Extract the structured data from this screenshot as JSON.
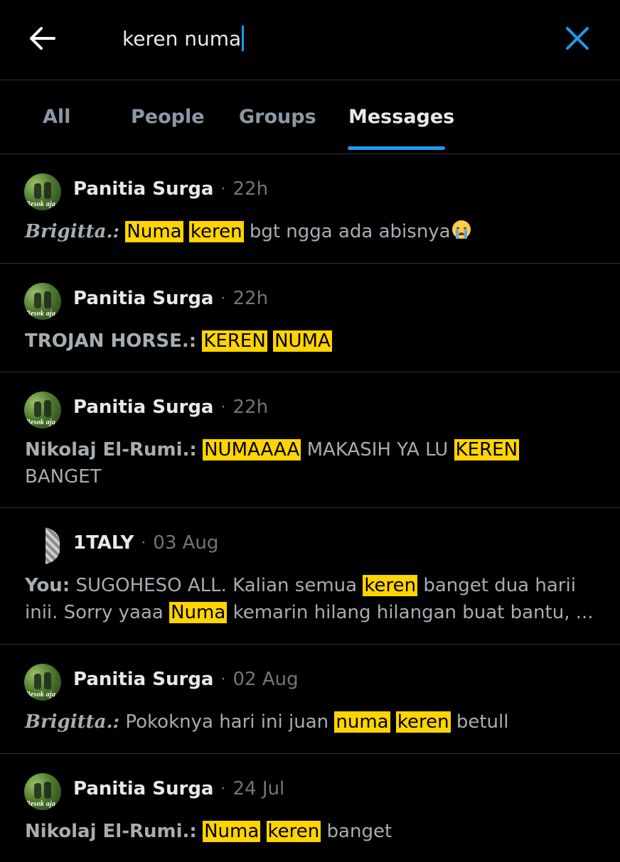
{
  "search": {
    "query": "keren numa"
  },
  "tabs": [
    {
      "label": "All",
      "active": false
    },
    {
      "label": "People",
      "active": false
    },
    {
      "label": "Groups",
      "active": false
    },
    {
      "label": "Messages",
      "active": true
    }
  ],
  "colors": {
    "accent": "#1d9bf0",
    "highlight": "#ffd400",
    "background": "#000000"
  },
  "icons": {
    "back": "arrow-left-icon",
    "clear": "close-icon"
  },
  "results": [
    {
      "avatar_text": "Besok aja",
      "group": "Panitia Surga",
      "dot": "·",
      "time": "22h",
      "sender": "Brigitta.:",
      "parts": [
        "Numa",
        "keren",
        "bgt ngga ada abisnya"
      ],
      "emoji": "crying-face-emoji"
    },
    {
      "avatar_text": "Besok aja",
      "group": "Panitia Surga",
      "dot": "·",
      "time": "22h",
      "sender": "TROJAN HORSE.:",
      "parts": [
        "KEREN",
        "NUMA"
      ]
    },
    {
      "avatar_text": "Besok aja",
      "group": "Panitia Surga",
      "dot": "·",
      "time": "22h",
      "sender": "Nikolaj El-Rumi.:",
      "parts": [
        "NUMAAAA",
        "MAKASIH YA LU",
        "KEREN",
        "BANGET"
      ]
    },
    {
      "group": "1TALY",
      "dot": "·",
      "time": "03 Aug",
      "sender": "You:",
      "parts": [
        "SUGOHESO ALL. Kalian semua",
        "keren",
        "banget dua harii inii. Sorry yaaa",
        "Numa",
        "kemarin hilang hilangan buat bantu, ..."
      ]
    },
    {
      "avatar_text": "Besok aja",
      "group": "Panitia Surga",
      "dot": "·",
      "time": "02 Aug",
      "sender": "Brigitta.:",
      "parts": [
        "Pokoknya hari ini juan",
        "numa",
        "keren",
        "betull"
      ]
    },
    {
      "avatar_text": "Besok aja",
      "group": "Panitia Surga",
      "dot": "·",
      "time": "24 Jul",
      "sender": "Nikolaj El-Rumi.:",
      "parts": [
        "Numa",
        "keren",
        "banget"
      ]
    }
  ]
}
